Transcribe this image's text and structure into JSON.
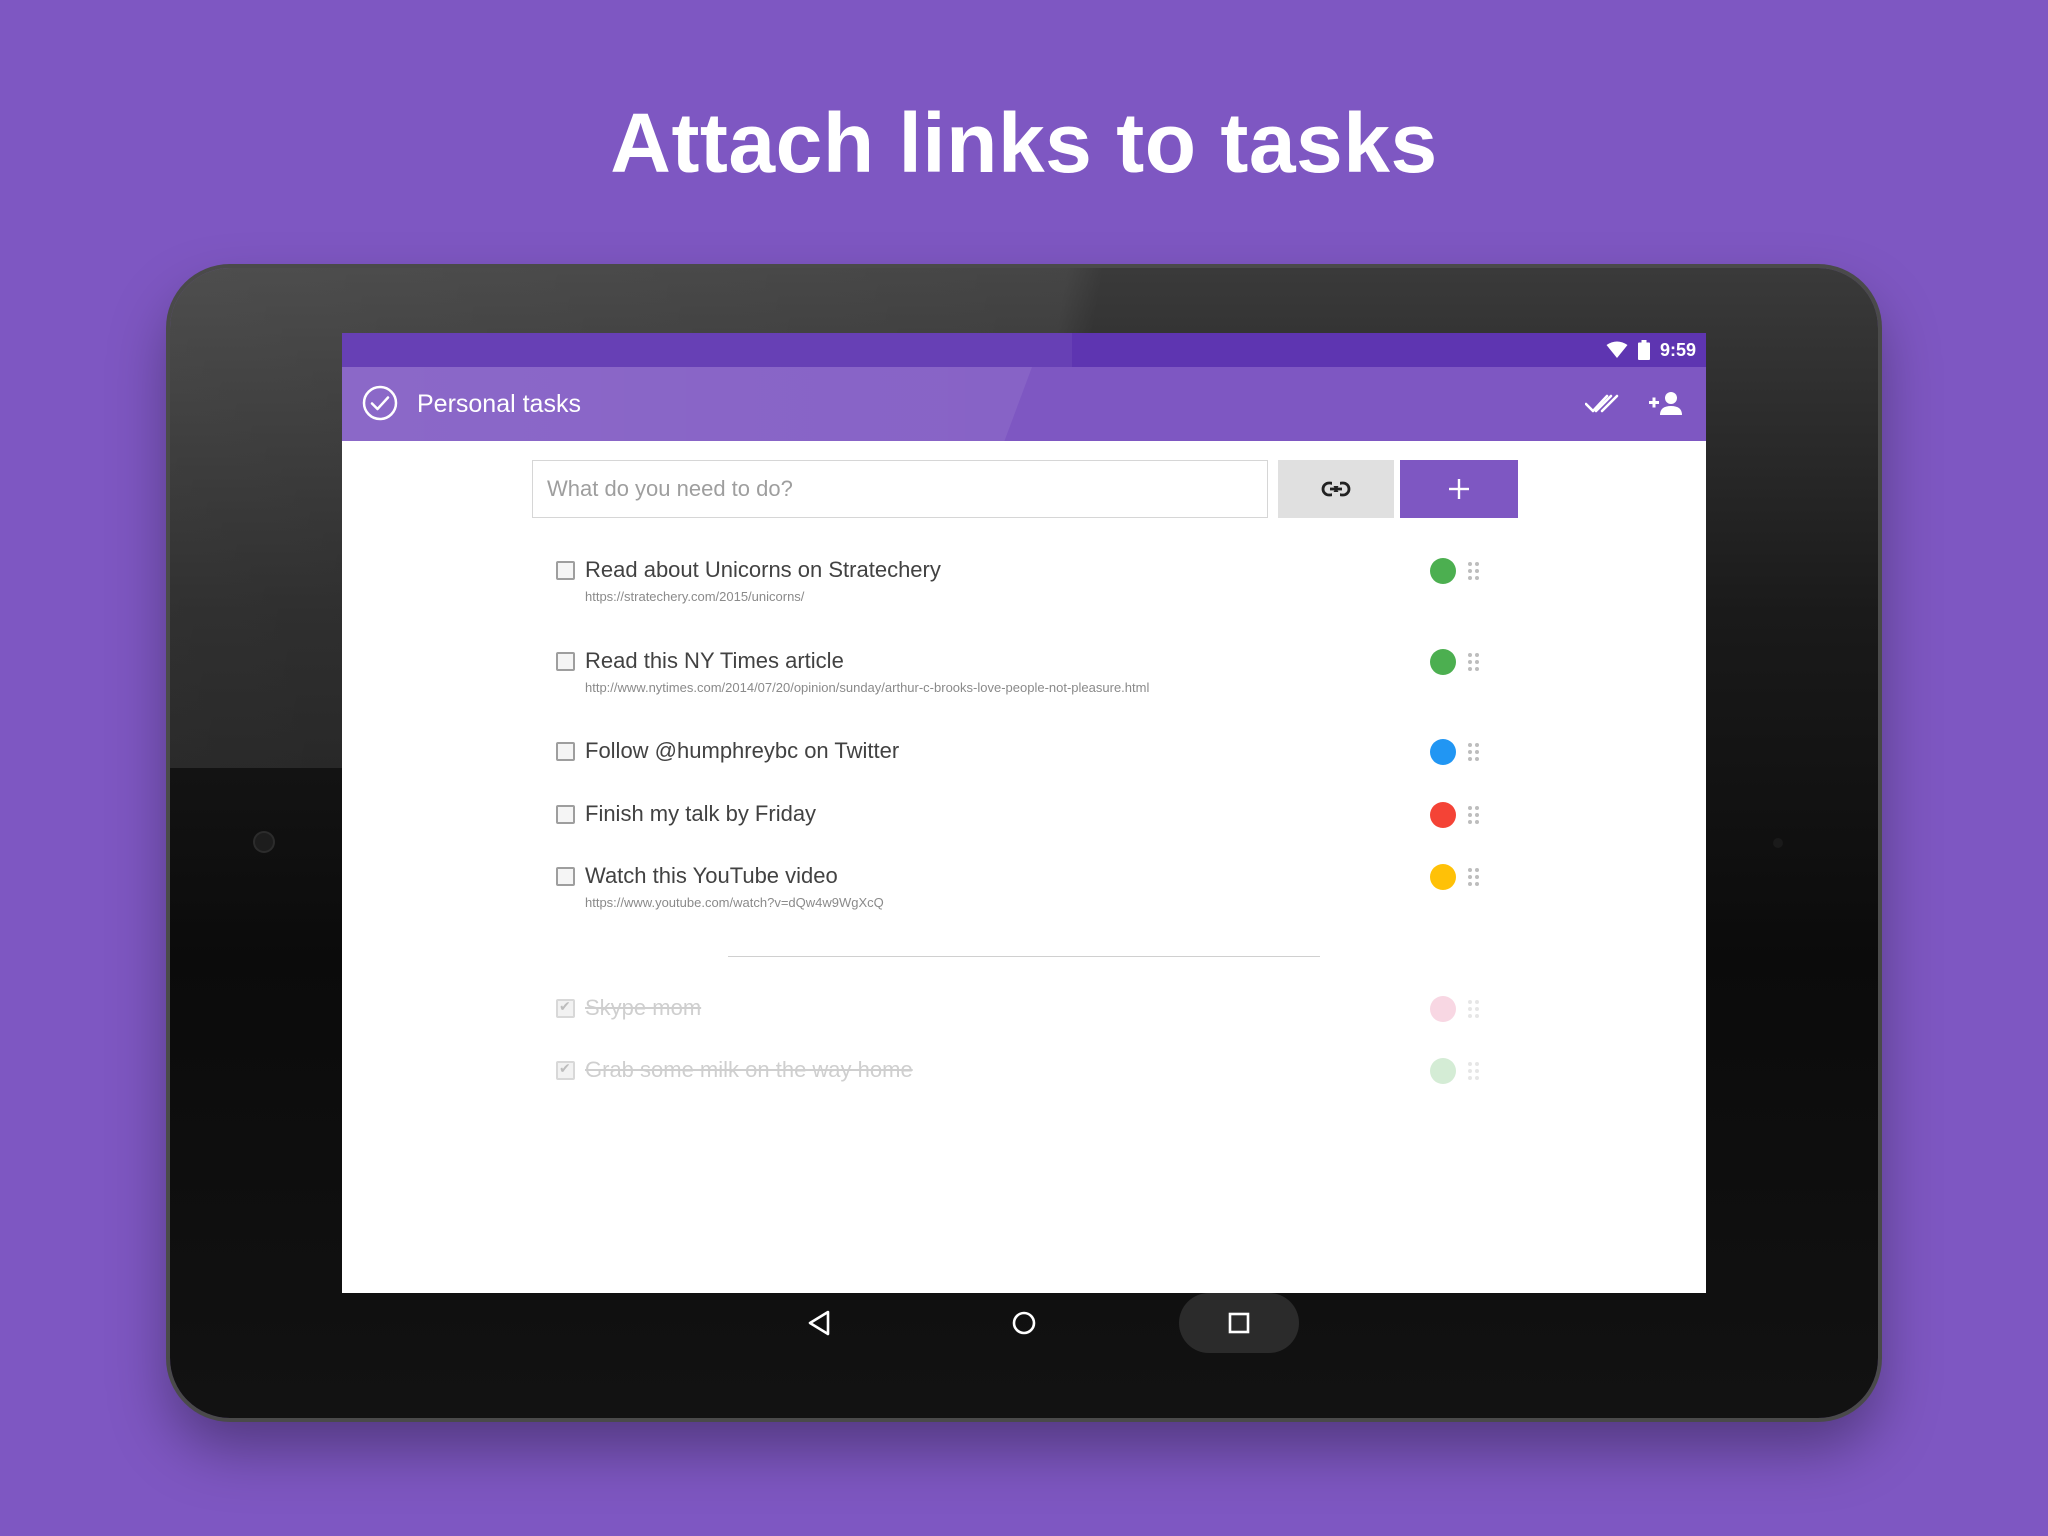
{
  "headline": "Attach links to tasks",
  "status_bar": {
    "time": "9:59",
    "icons": [
      "wifi-icon",
      "battery-icon"
    ]
  },
  "app_bar": {
    "title": "Personal tasks",
    "logo_icon": "check-circle-icon",
    "actions": [
      {
        "name": "mark-all-done",
        "icon": "double-check-icon"
      },
      {
        "name": "share",
        "icon": "add-person-icon"
      }
    ]
  },
  "new_task": {
    "placeholder": "What do you need to do?",
    "link_button_icon": "link-icon",
    "add_button_label": "+"
  },
  "tasks": [
    {
      "title": "Read about Unicorns on Stratechery",
      "link": "https://stratechery.com/2015/unicorns/",
      "color": "#4caf50",
      "done": false
    },
    {
      "title": "Read this NY Times article",
      "link": "http://www.nytimes.com/2014/07/20/opinion/sunday/arthur-c-brooks-love-people-not-pleasure.html",
      "color": "#4caf50",
      "done": false
    },
    {
      "title": "Follow @humphreybc on Twitter",
      "link": "",
      "color": "#2196f3",
      "done": false
    },
    {
      "title": "Finish my talk by Friday",
      "link": "",
      "color": "#f44336",
      "done": false
    },
    {
      "title": "Watch this YouTube video",
      "link": "https://www.youtube.com/watch?v=dQw4w9WgXcQ",
      "color": "#ffc107",
      "done": false
    }
  ],
  "completed_tasks": [
    {
      "title": "Skype mom",
      "color": "#f8d7e3",
      "done": true
    },
    {
      "title": "Grab some milk on the way home",
      "color": "#d4ecd5",
      "done": true
    }
  ],
  "nav_bar": {
    "buttons": [
      "back-icon",
      "home-icon",
      "recents-icon"
    ]
  }
}
